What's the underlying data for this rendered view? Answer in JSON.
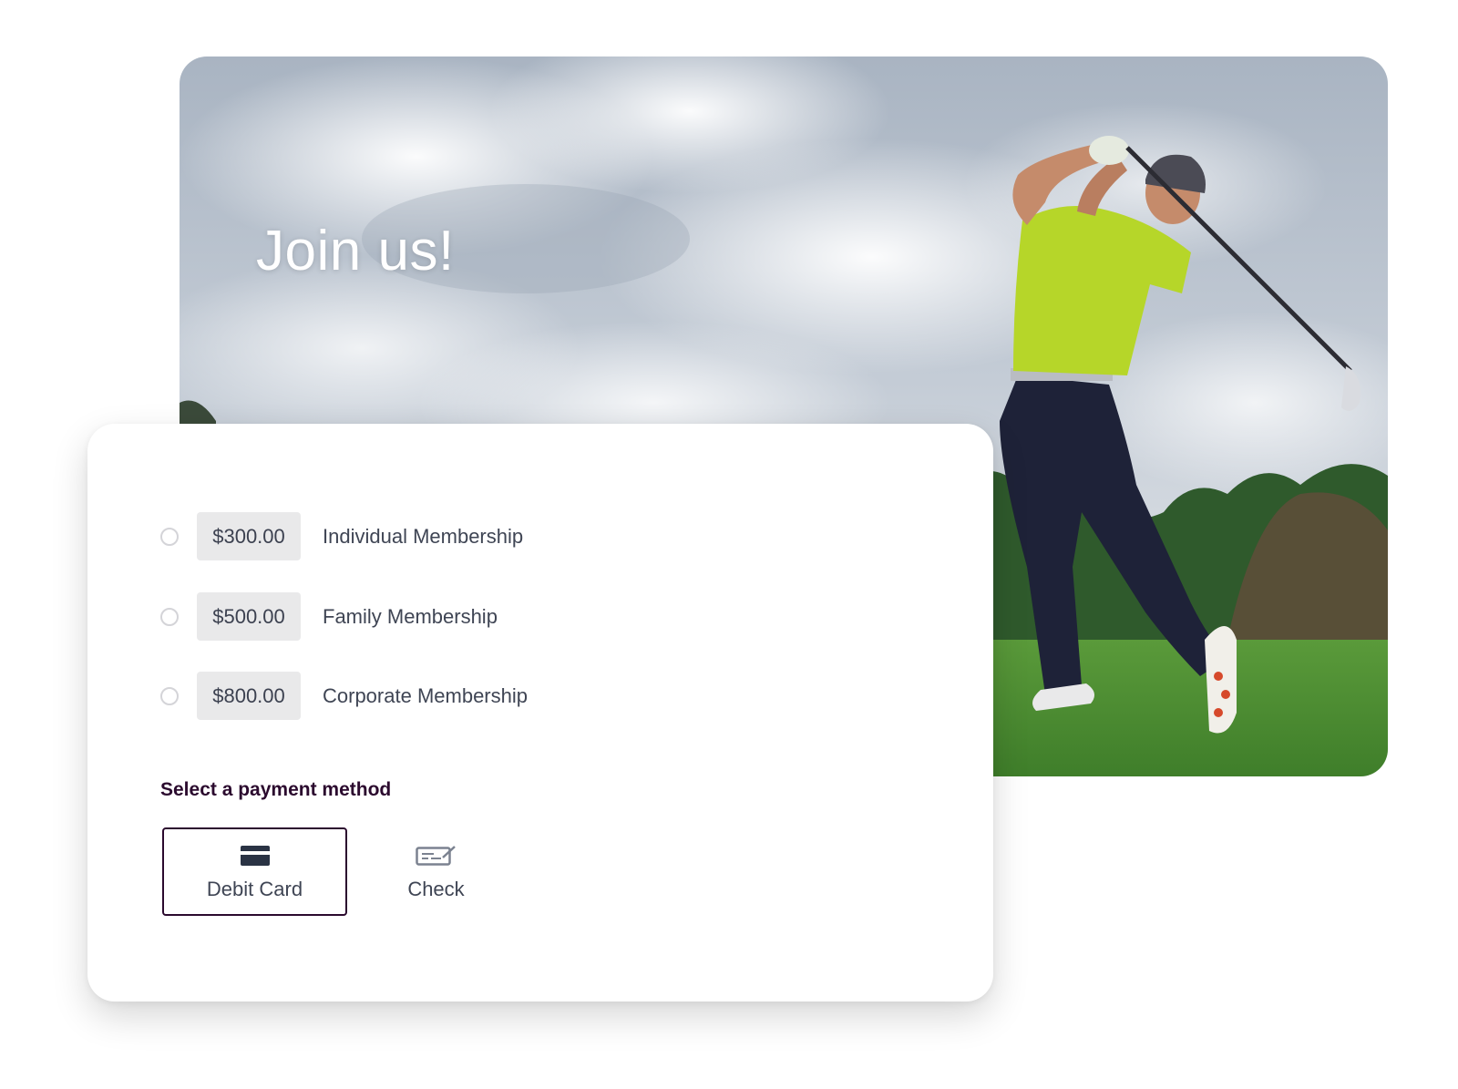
{
  "hero": {
    "title": "Join us!",
    "image": "golfer-swinging-photo"
  },
  "memberships": [
    {
      "price": "$300.00",
      "label": "Individual Membership",
      "selected": false
    },
    {
      "price": "$500.00",
      "label": "Family Membership",
      "selected": false
    },
    {
      "price": "$800.00",
      "label": "Corporate Membership",
      "selected": false
    }
  ],
  "payment": {
    "heading": "Select a payment method",
    "options": [
      {
        "label": "Debit Card",
        "icon": "credit-card-icon",
        "selected": true
      },
      {
        "label": "Check",
        "icon": "check-icon",
        "selected": false
      }
    ]
  },
  "colors": {
    "accent": "#2b0a2e",
    "price_bg": "#e9e9ea",
    "text": "#3f4554"
  }
}
